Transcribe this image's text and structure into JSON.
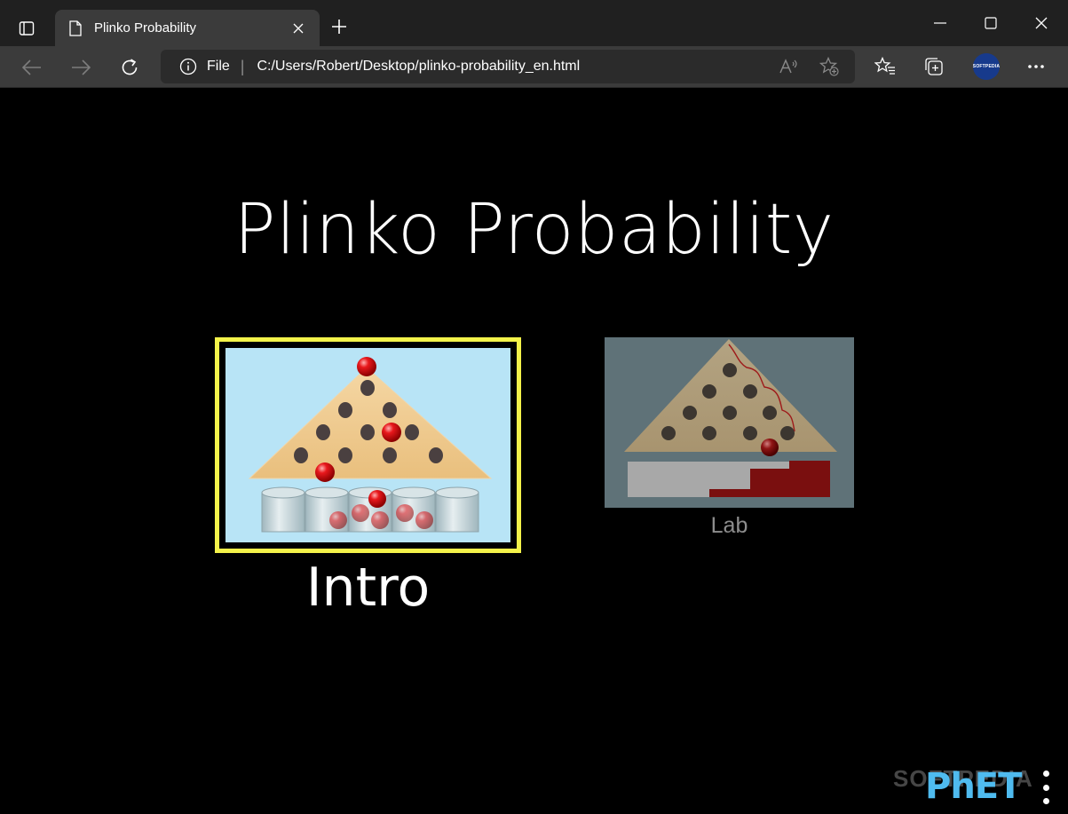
{
  "browser": {
    "tab_title": "Plinko Probability",
    "address_scheme": "File",
    "url": "C:/Users/Robert/Desktop/plinko-probability_en.html",
    "profile_label": "SOFTPEDIA"
  },
  "page": {
    "title": "Plinko Probability",
    "screens": [
      {
        "label": "Intro",
        "selected": true
      },
      {
        "label": "Lab",
        "selected": false
      }
    ],
    "logo": "PhET",
    "watermark": "SOFTPEDIA"
  },
  "colors": {
    "selected_border": "#f4f34a",
    "intro_background": "#b8e4f6",
    "lab_background": "#5f7278",
    "phet_blue": "#4fbbef",
    "phet_yellow": "#f9d31a"
  }
}
